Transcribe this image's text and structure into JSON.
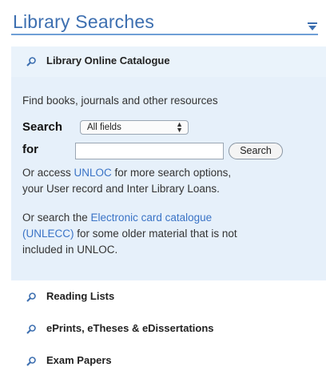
{
  "header": {
    "title": "Library Searches",
    "toggle_icon": "chevron-down-icon"
  },
  "catalogue": {
    "title": "Library Online Catalogue",
    "icon": "search-icon",
    "description": "Find books, journals and other resources",
    "search_label": "Search",
    "for_label": "for",
    "field_select": {
      "selected": "All fields"
    },
    "query_input": {
      "value": "",
      "placeholder": ""
    },
    "search_button": "Search",
    "access_text": {
      "prefix": "Or access ",
      "link": "UNLOC",
      "suffix_line1": " for more search options,",
      "line2": "your User record and Inter Library Loans."
    },
    "card_text": {
      "prefix": "Or search the ",
      "link_line1": "Electronic card catalogue",
      "link_line2": "(UNLECC)",
      "suffix_line2": " for some older material that is not",
      "line3": "included in UNLOC."
    }
  },
  "sections": [
    {
      "label": "Reading Lists",
      "icon": "search-icon"
    },
    {
      "label": "ePrints, eTheses & eDissertations",
      "icon": "search-icon"
    },
    {
      "label": "Exam Papers",
      "icon": "search-icon"
    }
  ],
  "colors": {
    "accent": "#3d6fb0",
    "link": "#3a73c6",
    "panel_bg": "#e6f0fa"
  }
}
